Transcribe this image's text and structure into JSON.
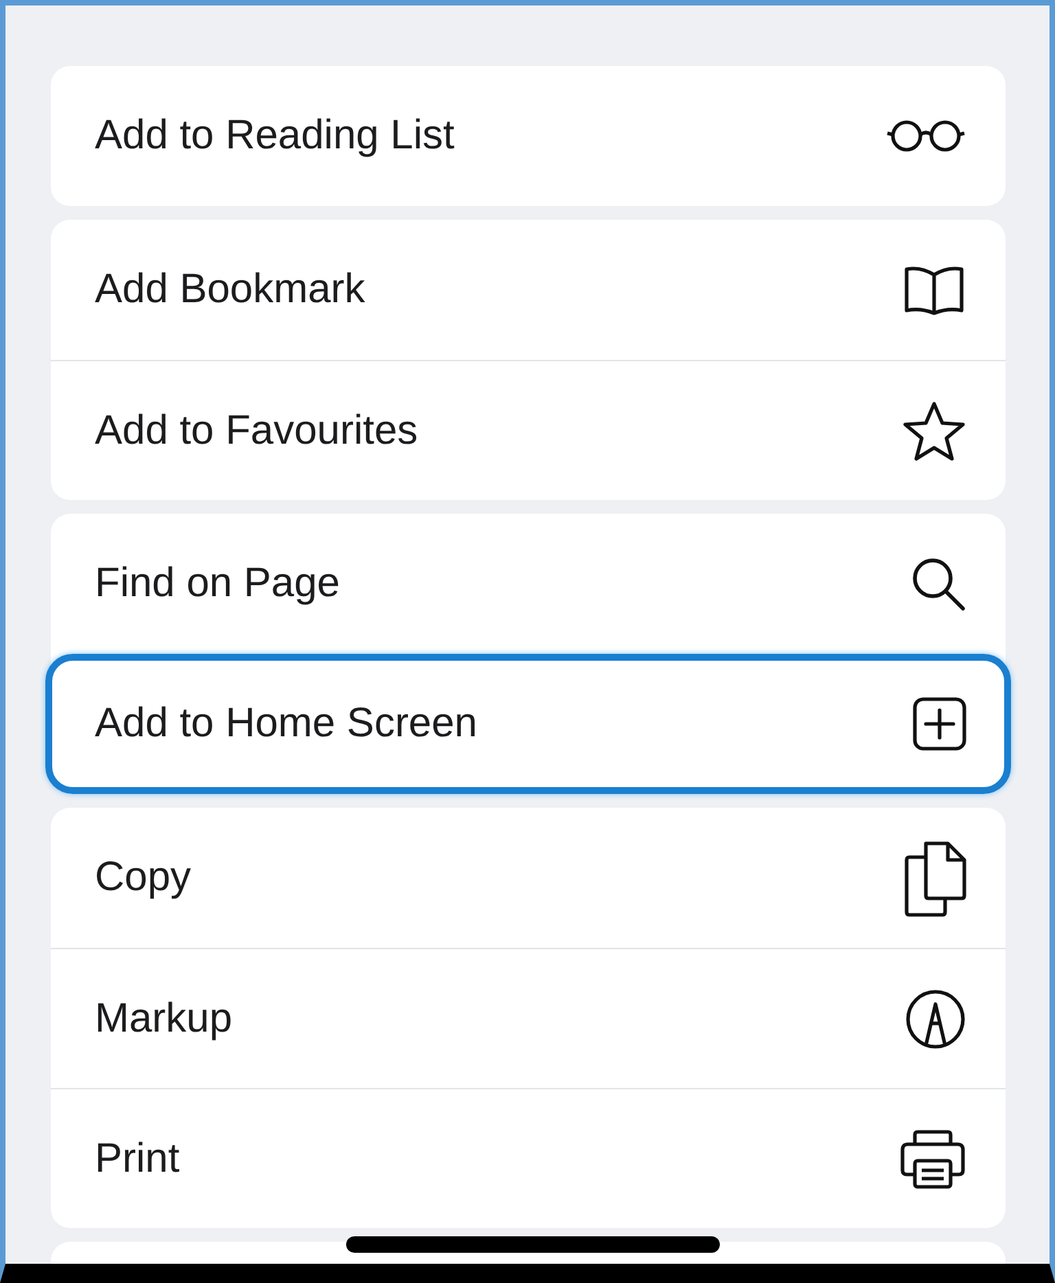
{
  "groups": [
    {
      "rows": [
        {
          "label": "Add to Reading List",
          "highlighted": false
        }
      ]
    },
    {
      "rows": [
        {
          "label": "Add Bookmark",
          "highlighted": false
        },
        {
          "label": "Add to Favourites",
          "highlighted": false
        }
      ]
    },
    {
      "rows": [
        {
          "label": "Find on Page",
          "highlighted": false
        },
        {
          "label": "Add to Home Screen",
          "highlighted": true
        }
      ]
    },
    {
      "rows": [
        {
          "label": "Copy",
          "highlighted": false
        },
        {
          "label": "Markup",
          "highlighted": false
        },
        {
          "label": "Print",
          "highlighted": false
        }
      ]
    }
  ]
}
